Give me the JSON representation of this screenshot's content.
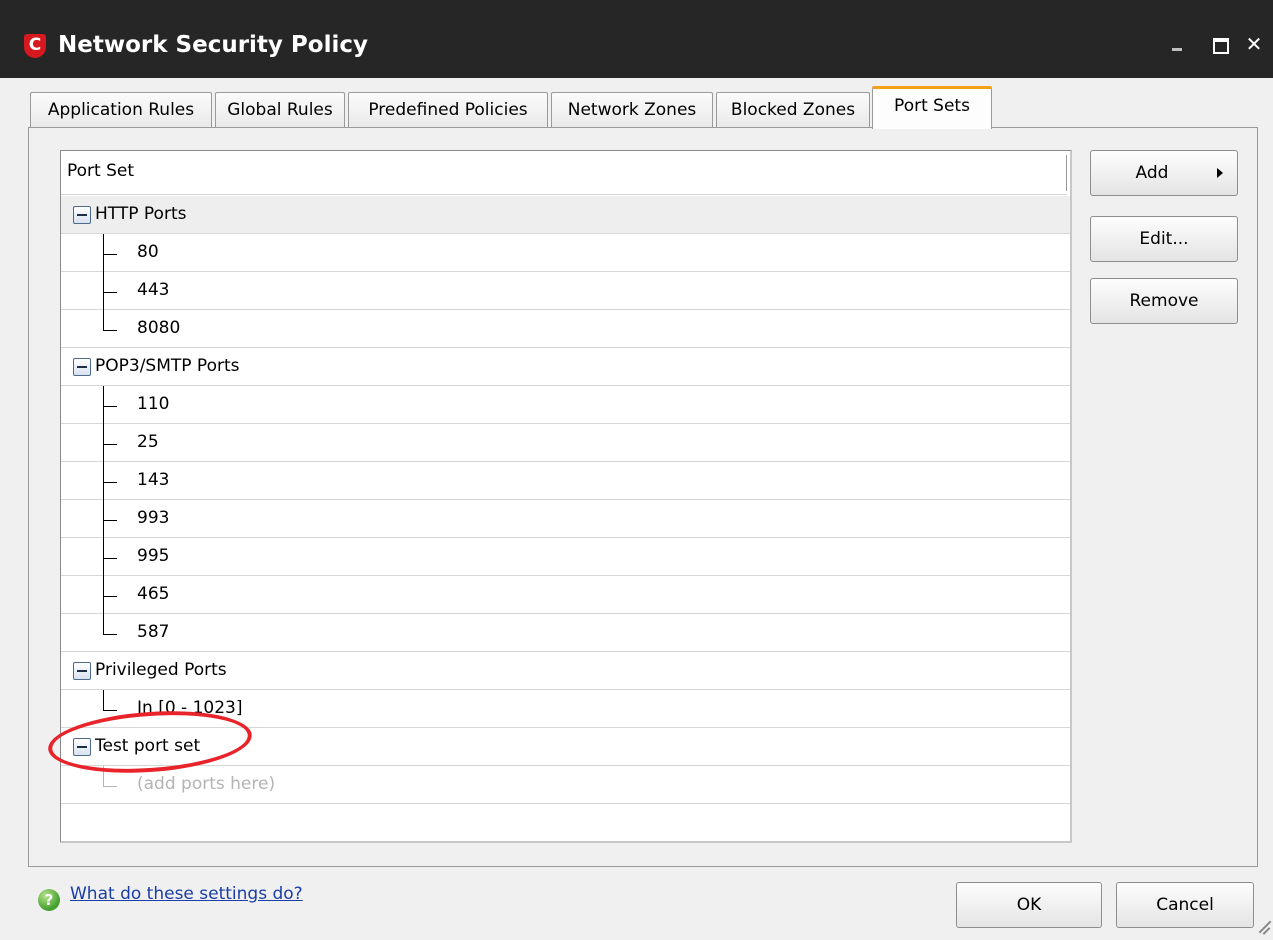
{
  "window": {
    "title": "Network Security Policy",
    "logo_letter": "C",
    "close_glyph": "✕"
  },
  "tabs": [
    {
      "label": "Application Rules"
    },
    {
      "label": "Global Rules"
    },
    {
      "label": "Predefined Policies"
    },
    {
      "label": "Network Zones"
    },
    {
      "label": "Blocked Zones"
    },
    {
      "label": "Port Sets",
      "active": true
    }
  ],
  "list": {
    "header": "Port Set",
    "groups": [
      {
        "name": "HTTP Ports",
        "ports": [
          "80",
          "443",
          "8080"
        ]
      },
      {
        "name": "POP3/SMTP Ports",
        "ports": [
          "110",
          "25",
          "143",
          "993",
          "995",
          "465",
          "587"
        ]
      },
      {
        "name": "Privileged Ports",
        "ports": [
          "In [0 - 1023]"
        ]
      },
      {
        "name": "Test port set",
        "placeholder": "(add ports here)"
      }
    ]
  },
  "buttons": {
    "add": "Add",
    "edit": "Edit...",
    "remove": "Remove",
    "ok": "OK",
    "cancel": "Cancel"
  },
  "help": {
    "link": "What do these settings do?",
    "icon": "?"
  },
  "colors": {
    "titlebar": "#262626",
    "logo": "#d6191f",
    "active_tab_accent": "#f1a21a",
    "annotation": "#e8232a",
    "link": "#1a3da8"
  }
}
